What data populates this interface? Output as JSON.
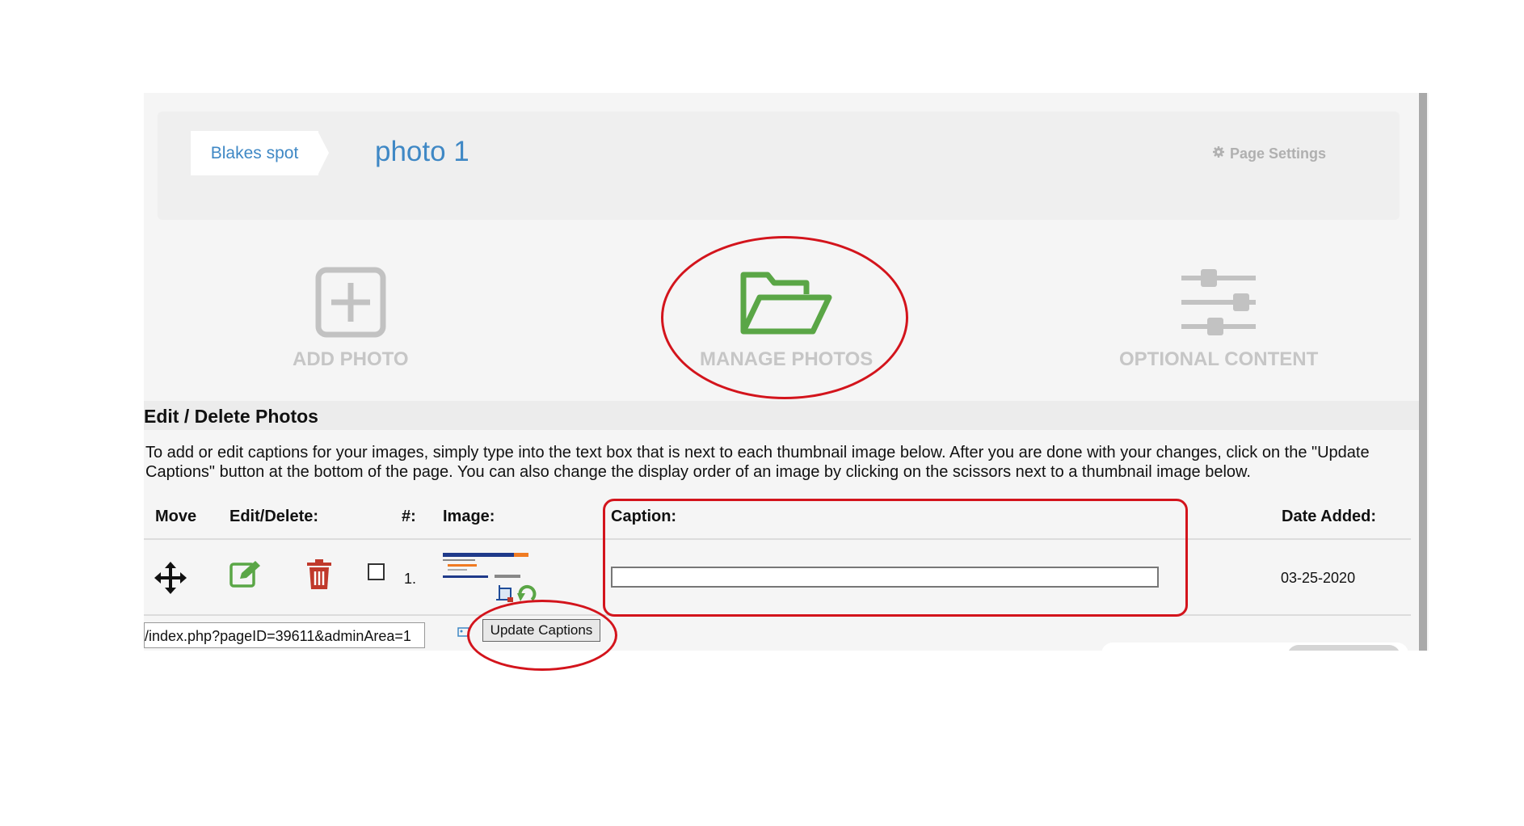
{
  "breadcrumb": {
    "parent": "Blakes spot",
    "title": "photo 1"
  },
  "page_settings": {
    "label": "Page Settings",
    "icon": "gear-icon"
  },
  "tools": [
    {
      "label": "ADD PHOTO",
      "icon": "plus-square-icon",
      "color": "#c2c2c2"
    },
    {
      "label": "MANAGE PHOTOS",
      "icon": "folder-open-icon",
      "color": "#5aa646"
    },
    {
      "label": "OPTIONAL CONTENT",
      "icon": "sliders-icon",
      "color": "#c2c2c2"
    }
  ],
  "section": {
    "title": "Edit / Delete Photos",
    "instructions": "To add or edit captions for your images, simply type into the text box that is next to each thumbnail image below. After you are done with your changes, click on the \"Update Captions\" button at the bottom of the page. You can also change the display order of an image by clicking on the scissors next to a thumbnail image below."
  },
  "table": {
    "headers": {
      "move": "Move",
      "edit_delete": "Edit/Delete:",
      "number": "#:",
      "image": "Image:",
      "caption": "Caption:",
      "date_added": "Date Added:"
    },
    "rows": [
      {
        "number": "1.",
        "caption": "",
        "date_added": "03-25-2020"
      }
    ]
  },
  "tooltip": "/index.php?pageID=39611&adminArea=1",
  "update_button": "Update Captions",
  "colors": {
    "link": "#3f88c5",
    "edit_green": "#5aa646",
    "delete_red": "#c0392b",
    "annotation_red": "#d3141c"
  }
}
